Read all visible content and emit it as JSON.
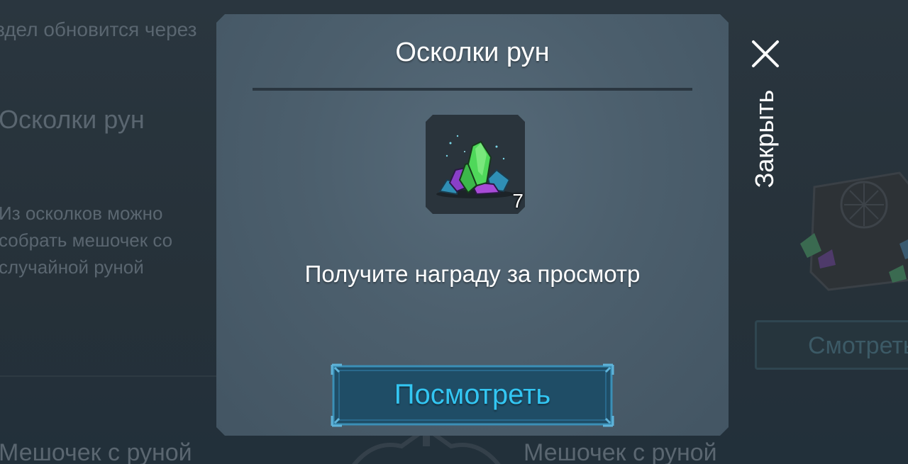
{
  "background": {
    "refresh_text": "здел обновится через",
    "section_title": "Осколки рун",
    "description": "Из осколков можно собрать мешочек со случайной руной",
    "watch_label": "Смотреть",
    "bottom_left_title": "Мешочек с руной",
    "bottom_right_title": "Мешочек с руной"
  },
  "close": {
    "label": "Закрыть",
    "icon": "close-icon"
  },
  "modal": {
    "title": "Осколки рун",
    "reward": {
      "icon": "rune-shards-icon",
      "count": "7"
    },
    "message": "Получите награду за просмотр",
    "watch_button_label": "Посмотреть"
  },
  "colors": {
    "modal_bg": "#4c5f6d",
    "accent": "#33c6f2",
    "button_bg": "#1f4d66",
    "button_border": "#3b8fb6"
  }
}
